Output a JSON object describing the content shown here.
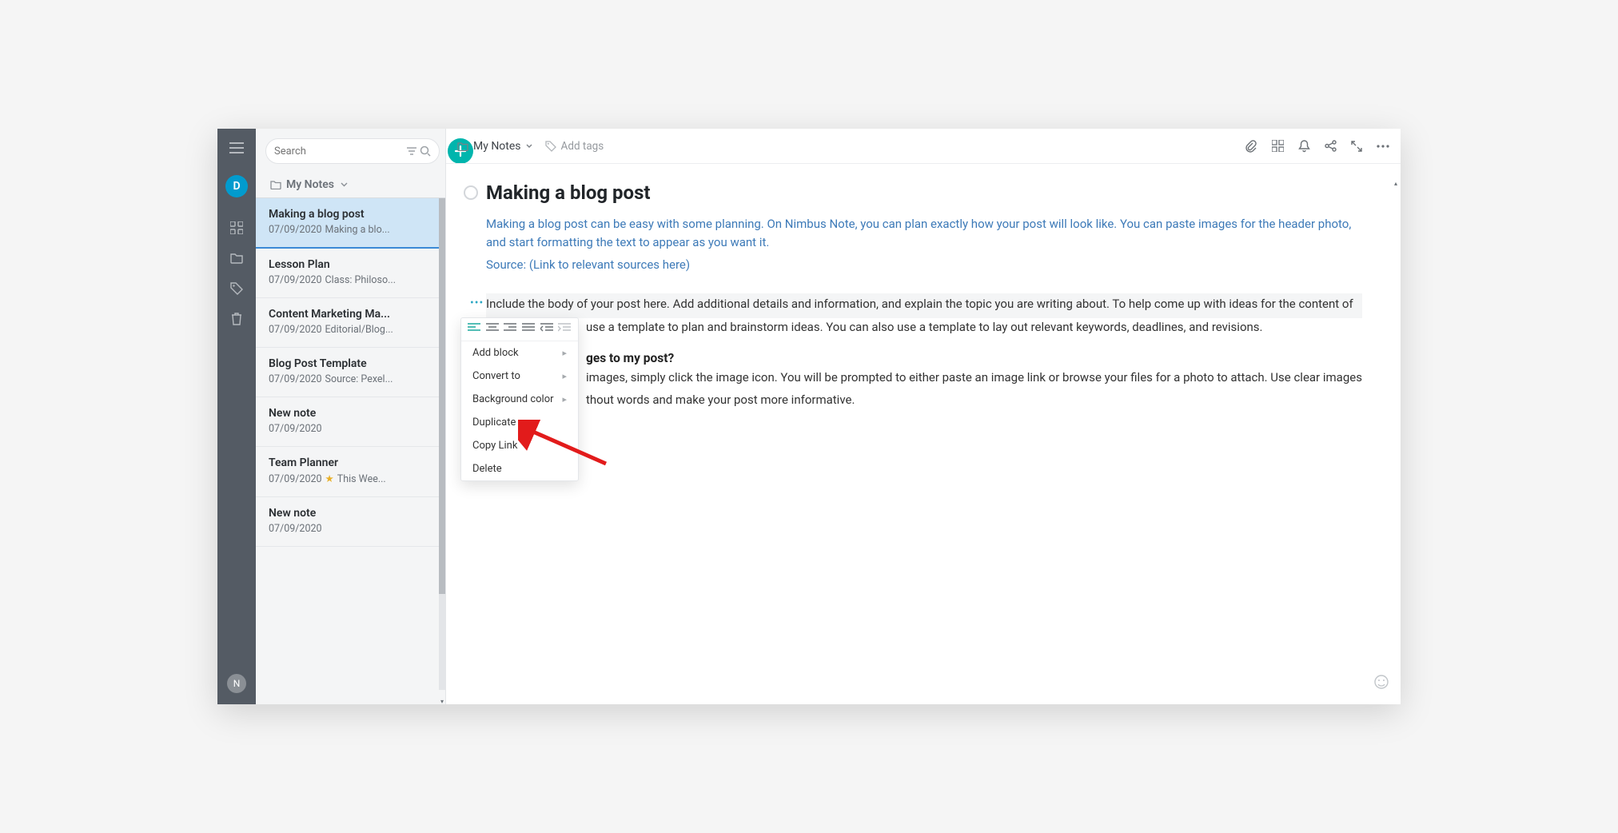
{
  "rail": {
    "avatar_top": "D",
    "avatar_bottom": "N"
  },
  "sidebar": {
    "search_placeholder": "Search",
    "folder_label": "My Notes",
    "notes": [
      {
        "title": "Making a blog post",
        "date": "07/09/2020",
        "preview": "Making a blo..."
      },
      {
        "title": "Lesson Plan",
        "date": "07/09/2020",
        "preview": "Class: Philoso..."
      },
      {
        "title": "Content Marketing Ma...",
        "date": "07/09/2020",
        "preview": "Editorial/Blog..."
      },
      {
        "title": "Blog Post Template",
        "date": "07/09/2020",
        "preview": "Source: Pexel..."
      },
      {
        "title": "New note",
        "date": "07/09/2020",
        "preview": ""
      },
      {
        "title": "Team Planner",
        "date": "07/09/2020",
        "preview": "This Wee...",
        "starred": true
      },
      {
        "title": "New note",
        "date": "07/09/2020",
        "preview": ""
      }
    ]
  },
  "toolbar": {
    "breadcrumb": "My Notes",
    "add_tags": "Add tags"
  },
  "doc": {
    "title": "Making a blog post",
    "intro1": "Making a blog post can be easy with some planning. On Nimbus Note, you can plan exactly how your post will look like. You can paste images for the header photo, and start formatting the text to appear as you want it.",
    "intro2": "Source: (Link to relevant sources here)",
    "body1": "Include the body of your post here. Add additional details and information, and explain the topic you are writing about. To help come up with ideas for the content of",
    "body1b_suffix": "use a template to plan and brainstorm ideas. You can also use a template to lay out relevant keywords, deadlines, and revisions.",
    "subhead_suffix": "ges to my post?",
    "body2_suffix": "images, simply click the image icon. You will be prompted to either paste an image link or browse your files for a photo to attach. Use clear images",
    "body2b_suffix": "thout words and make your post more informative."
  },
  "ctx": {
    "add_block": "Add block",
    "convert_to": "Convert to",
    "bg_color": "Background color",
    "duplicate": "Duplicate",
    "copy_link": "Copy Link",
    "delete": "Delete"
  }
}
